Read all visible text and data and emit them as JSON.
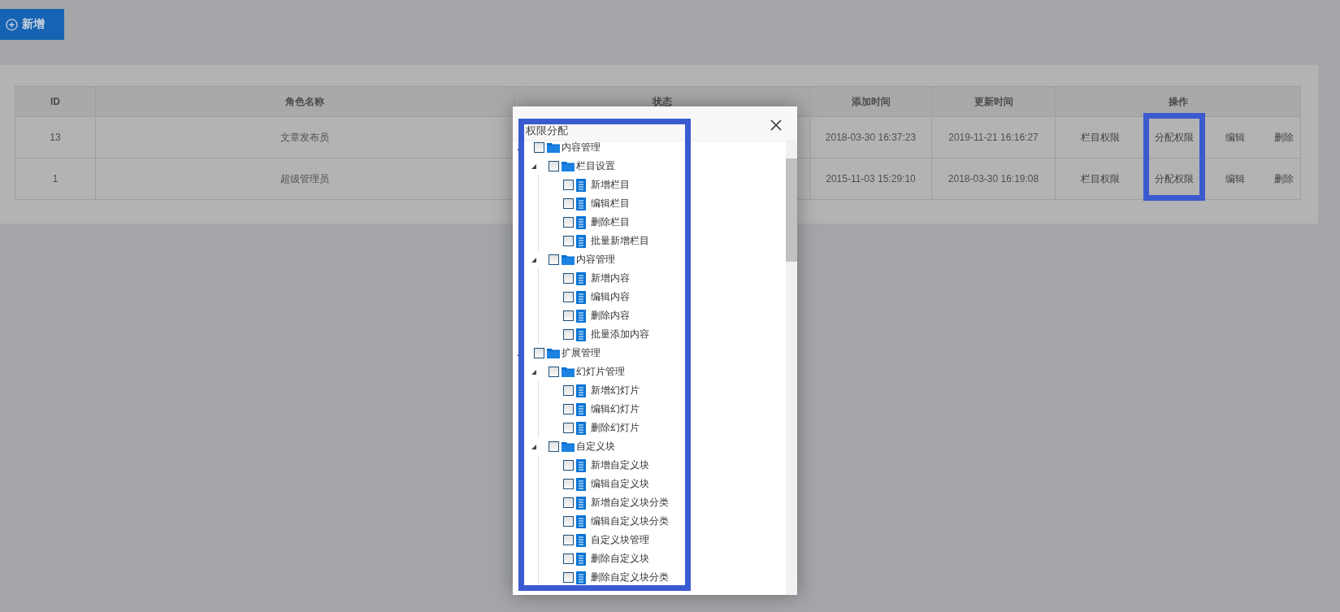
{
  "toolbar": {
    "add_button": "新增"
  },
  "table": {
    "columns": [
      "ID",
      "角色名称",
      "状态",
      "添加时间",
      "更新时间",
      "操作"
    ],
    "action_columns": [
      {
        "highlighted": false
      },
      {
        "highlighted": true
      },
      {
        "highlighted": false
      },
      {
        "highlighted": false
      }
    ],
    "rows": [
      {
        "id": "13",
        "name": "文章发布员",
        "added": "2018-03-30 16:37:23",
        "updated": "2019-11-21 16:16:27",
        "actions": [
          "栏目权限",
          "分配权限",
          "编辑",
          "删除"
        ]
      },
      {
        "id": "1",
        "name": "超级管理员",
        "added": "2015-11-03 15:29:10",
        "updated": "2018-03-30 16:19:08",
        "actions": [
          "栏目权限",
          "分配权限",
          "编辑",
          "删除"
        ]
      }
    ]
  },
  "dialog": {
    "title": "权限分配",
    "tree_highlighted": true,
    "tree": [
      {
        "label": "内容管理",
        "checked": false,
        "expanded": true,
        "children": [
          {
            "label": "栏目设置",
            "checked": false,
            "expanded": true,
            "children": [
              {
                "label": "新增栏目",
                "checked": false
              },
              {
                "label": "编辑栏目",
                "checked": false
              },
              {
                "label": "删除栏目",
                "checked": false
              },
              {
                "label": "批量新增栏目",
                "checked": false
              }
            ]
          },
          {
            "label": "内容管理",
            "checked": false,
            "expanded": true,
            "children": [
              {
                "label": "新增内容",
                "checked": false
              },
              {
                "label": "编辑内容",
                "checked": false
              },
              {
                "label": "删除内容",
                "checked": false
              },
              {
                "label": "批量添加内容",
                "checked": false
              }
            ]
          }
        ]
      },
      {
        "label": "扩展管理",
        "checked": false,
        "expanded": true,
        "children": [
          {
            "label": "幻灯片管理",
            "checked": false,
            "expanded": true,
            "children": [
              {
                "label": "新增幻灯片",
                "checked": false
              },
              {
                "label": "编辑幻灯片",
                "checked": false
              },
              {
                "label": "删除幻灯片",
                "checked": false
              }
            ]
          },
          {
            "label": "自定义块",
            "checked": false,
            "expanded": true,
            "children": [
              {
                "label": "新增自定义块",
                "checked": false
              },
              {
                "label": "编辑自定义块",
                "checked": false
              },
              {
                "label": "新增自定义块分类",
                "checked": false
              },
              {
                "label": "编辑自定义块分类",
                "checked": false
              },
              {
                "label": "自定义块管理",
                "checked": false
              },
              {
                "label": "删除自定义块",
                "checked": false
              },
              {
                "label": "删除自定义块分类",
                "checked": false
              }
            ]
          }
        ]
      }
    ]
  }
}
